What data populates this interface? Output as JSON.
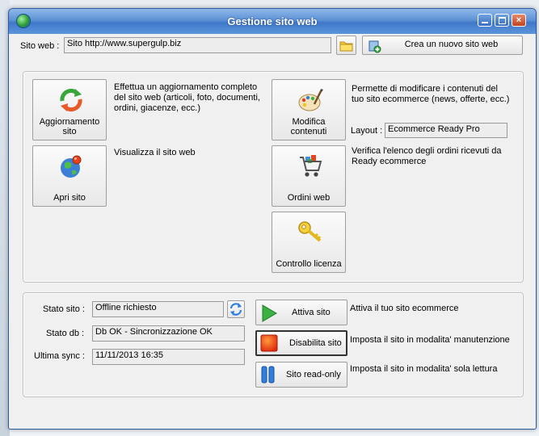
{
  "window": {
    "title": "Gestione sito web"
  },
  "site": {
    "label": "Sito web :",
    "value": "Sito http://www.supergulp.biz",
    "new_site_button": "Crea un nuovo sito web"
  },
  "actions": {
    "update": {
      "label": "Aggiornamento sito",
      "desc": "Effettua un aggiornamento completo del sito web (articoli, foto, documenti, ordini, giacenze, ecc.)"
    },
    "open": {
      "label": "Apri sito",
      "desc": "Visualizza il sito web"
    },
    "edit": {
      "label": "Modifica contenuti",
      "desc": "Permette di modificare i contenuti del tuo sito ecommerce (news, offerte, ecc.)"
    },
    "layout": {
      "label": "Layout :",
      "value": "Ecommerce Ready Pro"
    },
    "orders": {
      "label": "Ordini web",
      "desc": "Verifica l'elenco degli ordini ricevuti da Ready ecommerce"
    },
    "license": {
      "label": "Controllo licenza"
    }
  },
  "status": {
    "site_label": "Stato sito :",
    "site_value": "Offline richiesto",
    "db_label": "Stato db :",
    "db_value": "Db OK - Sincronizzazione OK",
    "sync_label": "Ultima sync :",
    "sync_value": "11/11/2013 16:35"
  },
  "controls": {
    "activate": {
      "label": "Attiva sito",
      "desc": "Attiva il tuo sito ecommerce"
    },
    "disable": {
      "label": "Disabilita sito",
      "desc": "Imposta il sito in modalita' manutenzione"
    },
    "readonly": {
      "label": "Sito read-only",
      "desc": "Imposta il sito in modalita' sola lettura"
    }
  },
  "icons": {
    "app": "globe-icon",
    "folder": "folder-icon",
    "new_site": "new-site-icon",
    "update": "refresh-arrows-icon",
    "open": "globe-icon",
    "edit": "palette-icon",
    "orders": "shopping-cart-icon",
    "license": "key-icon",
    "refresh_status": "refresh-icon",
    "activate": "play-icon",
    "disable": "stop-icon",
    "readonly": "pause-icon"
  }
}
